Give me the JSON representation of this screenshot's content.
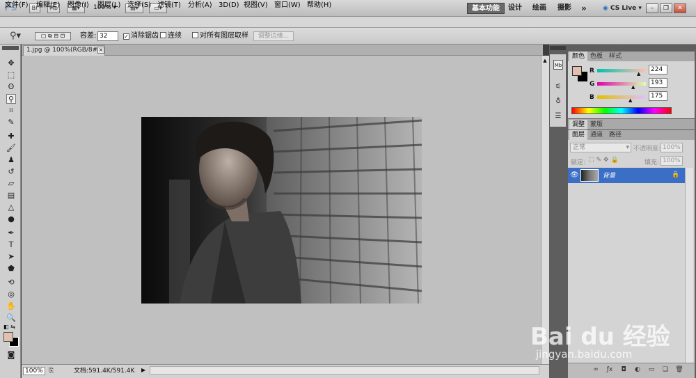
{
  "app": {
    "logo": "Ps",
    "bridge_btn": "Br",
    "minibridge_btn": "Mb",
    "zoom_level": "100%",
    "workspaces": [
      "基本功能",
      "设计",
      "绘画",
      "摄影"
    ],
    "more": "»",
    "cs_live": "CS Live"
  },
  "menu": [
    "文件(F)",
    "编辑(E)",
    "图像(I)",
    "图层(L)",
    "选择(S)",
    "滤镜(T)",
    "分析(A)",
    "3D(D)",
    "视图(V)",
    "窗口(W)",
    "帮助(H)"
  ],
  "options": {
    "tolerance_label": "容差:",
    "tolerance_value": "32",
    "antialias_label": "消除锯齿",
    "antialias_checked": true,
    "contiguous_label": "连续",
    "contiguous_checked": false,
    "sample_all_label": "对所有图层取样",
    "sample_all_checked": false,
    "refine_edge": "调整边缘..."
  },
  "document": {
    "tab_title": "1.jpg @ 100%(RGB/8#)",
    "close": "×",
    "zoom": "100%",
    "doc_info": "文档:591.4K/591.4K"
  },
  "color_panel": {
    "tabs": [
      "颜色",
      "色板",
      "样式"
    ],
    "foreground_color": "#e0c1af",
    "background_color": "#000000",
    "r_label": "R",
    "r": 224,
    "g_label": "G",
    "g": 193,
    "b_label": "B",
    "b": 175
  },
  "adjust_panel": {
    "tabs": [
      "调整",
      "蒙版"
    ]
  },
  "layers_panel": {
    "tabs": [
      "图层",
      "通道",
      "路径"
    ],
    "blend_mode": "正常",
    "opacity_label": "不透明度:",
    "opacity": "100%",
    "lock_label": "锁定:",
    "fill_label": "填充:",
    "fill": "100%",
    "layers": [
      {
        "name": "背景",
        "visible": true,
        "locked": true
      }
    ]
  },
  "watermark": {
    "logo": "Bai du 经验",
    "url": "jingyan.baidu.com"
  },
  "colors": {
    "selection_blue": "#3b6fc6",
    "canvas_gray": "#c0c0c0",
    "panel_dark": "#5e5e5e"
  }
}
